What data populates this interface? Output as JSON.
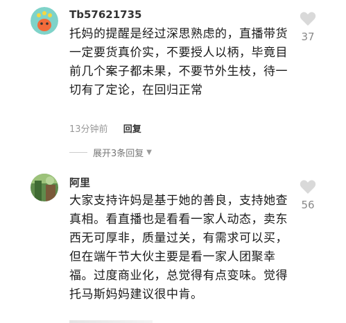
{
  "comments": [
    {
      "username": "Tb57621735",
      "text": "托妈的提醒是经过深思熟虑的，直播带货一定要货真价实，不要授人以柄，毕竟目前几个案子都未果，不要节外生枝，待一切有了定论，在回归正常",
      "likes": "37",
      "time": "13分钟前",
      "reply_label": "回复",
      "expand_label": "展开3条回复"
    },
    {
      "username": "阿里",
      "text": "大家支持许妈是基于她的善良，支持她查真相。看直播也是看看一家人动态，卖东西无可厚非，质量过关，有需求可以买，但在端午节大伙主要是看一家人团聚幸福。过度商业化，总觉得有点变味。觉得托马斯妈妈建议很中肯。",
      "likes": "56"
    }
  ],
  "icons": {
    "like": "heart-icon",
    "expand": "chevron-down-icon"
  },
  "colors": {
    "heart": "#d9d9d9",
    "meta": "#999999"
  }
}
